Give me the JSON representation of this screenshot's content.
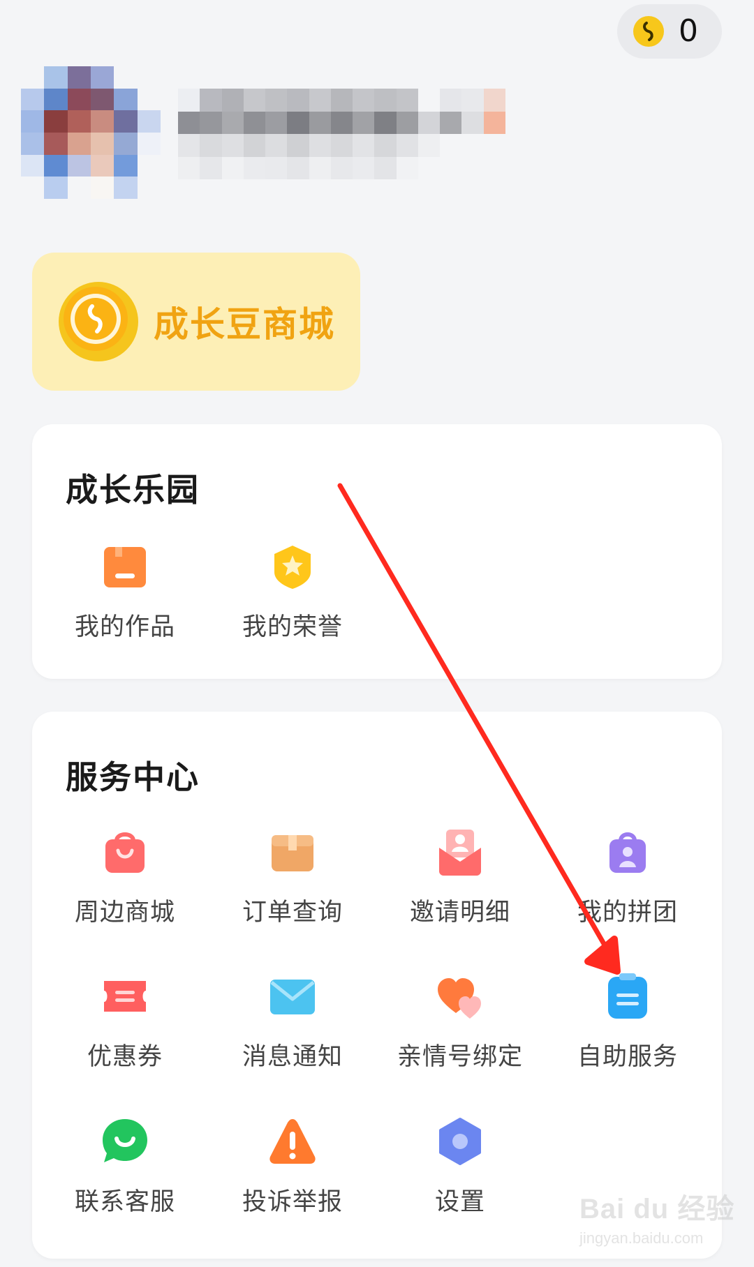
{
  "header": {
    "coin_count": "0"
  },
  "shop_card": {
    "label": "成长豆商城"
  },
  "growth_park": {
    "title": "成长乐园",
    "items": [
      {
        "label": "我的作品",
        "icon": "works-icon"
      },
      {
        "label": "我的荣誉",
        "icon": "honor-badge-icon"
      }
    ]
  },
  "service_center": {
    "title": "服务中心",
    "items": [
      {
        "label": "周边商城",
        "icon": "shopping-bag-icon"
      },
      {
        "label": "订单查询",
        "icon": "package-box-icon"
      },
      {
        "label": "邀请明细",
        "icon": "invite-envelope-icon"
      },
      {
        "label": "我的拼团",
        "icon": "group-buy-bag-icon"
      },
      {
        "label": "优惠券",
        "icon": "coupon-ticket-icon"
      },
      {
        "label": "消息通知",
        "icon": "mail-icon"
      },
      {
        "label": "亲情号绑定",
        "icon": "hearts-icon"
      },
      {
        "label": "自助服务",
        "icon": "self-service-clipboard-icon"
      },
      {
        "label": "联系客服",
        "icon": "chat-bubble-icon"
      },
      {
        "label": "投诉举报",
        "icon": "warning-triangle-icon"
      },
      {
        "label": "设置",
        "icon": "settings-hexagon-icon"
      }
    ]
  },
  "watermark": {
    "brand": "Bai du 经验",
    "url": "jingyan.baidu.com"
  },
  "colors": {
    "background": "#f4f5f7",
    "shop_card_bg": "#fdefb6",
    "shop_label": "#f0a312",
    "annotation_arrow": "#ff2a1f"
  }
}
